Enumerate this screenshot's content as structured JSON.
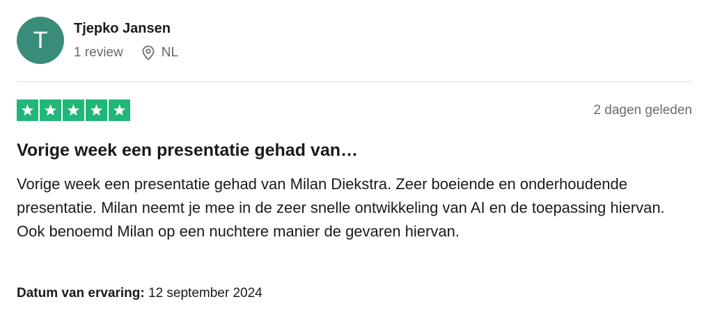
{
  "reviewer": {
    "initial": "T",
    "name": "Tjepko Jansen",
    "review_count": "1 review",
    "country": "NL",
    "avatar_color": "#3a8c7a"
  },
  "rating": {
    "stars": 5,
    "max_stars": 5,
    "star_color": "#21b67a",
    "date_posted": "2 dagen geleden"
  },
  "review": {
    "title": "Vorige week een presentatie gehad van…",
    "body": "Vorige week een presentatie gehad van Milan Diekstra. Zeer boeiende en onderhoudende presentatie. Milan neemt je mee in de zeer snelle ontwikkeling van AI en de toepassing hiervan. Ook benoemd Milan op een nuchtere manier de gevaren hiervan."
  },
  "experience": {
    "label": "Datum van ervaring:",
    "date": "12 september 2024"
  },
  "icons": {
    "location": "location-pin-icon",
    "star": "star-icon"
  }
}
